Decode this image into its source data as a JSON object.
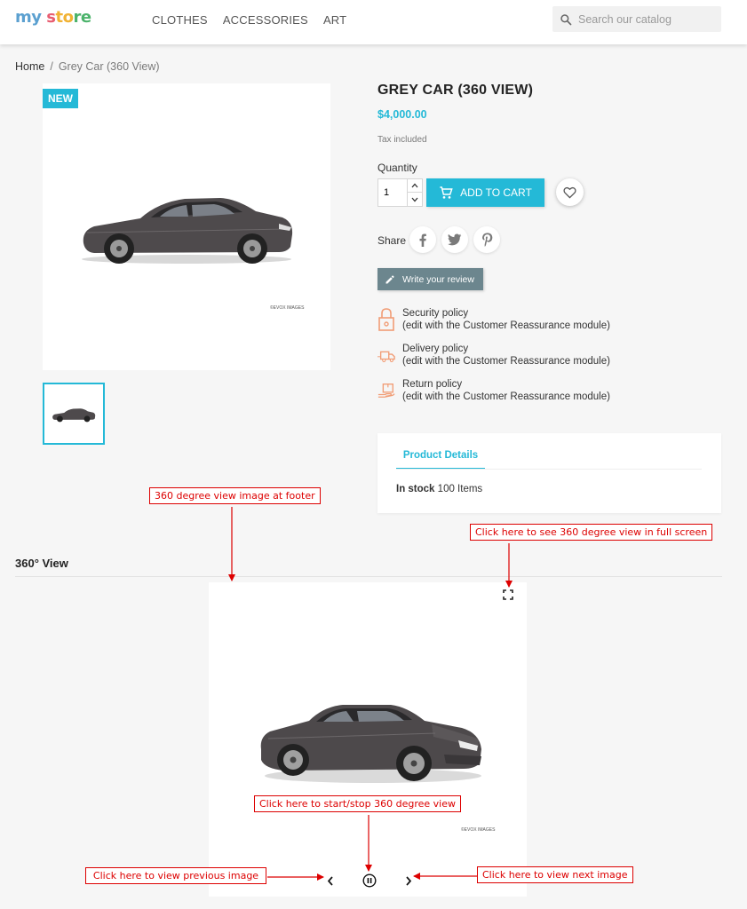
{
  "header": {
    "logo": {
      "my": "my",
      "s": "s",
      "to": "to",
      "re": "re"
    },
    "nav": [
      "CLOTHES",
      "ACCESSORIES",
      "ART"
    ],
    "search_placeholder": "Search our catalog"
  },
  "breadcrumb": {
    "home": "Home",
    "separator": "/",
    "current": "Grey Car (360 View)"
  },
  "product": {
    "badge": "NEW",
    "title": "GREY CAR (360 VIEW)",
    "price": "$4,000.00",
    "tax_note": "Tax included",
    "quantity_label": "Quantity",
    "quantity_value": "1",
    "add_to_cart": "ADD TO CART",
    "share_label": "Share",
    "write_review": "Write your review",
    "watermark": "©EVOX IMAGES"
  },
  "reassurance": [
    {
      "title": "Security policy",
      "note": "(edit with the Customer Reassurance module)",
      "icon": "lock-icon"
    },
    {
      "title": "Delivery policy",
      "note": "(edit with the Customer Reassurance module)",
      "icon": "truck-icon"
    },
    {
      "title": "Return policy",
      "note": "(edit with the Customer Reassurance module)",
      "icon": "return-box-icon"
    }
  ],
  "details": {
    "tab": "Product Details",
    "stock_label": "In stock",
    "stock_value": "100 Items"
  },
  "viewer": {
    "section_title": "360° View"
  },
  "annotations": {
    "footer": "360 degree view image at footer",
    "fullscreen": "Click here to see 360 degree view in full screen",
    "startstop": "Click here to start/stop 360 degree view",
    "previous": "Click here to view previous image",
    "next": "Click here to view next image"
  },
  "colors": {
    "accent": "#24b9d7",
    "review_button": "#6c868e",
    "annotation": "#dd0000",
    "reassurance_icon": "#f19d76"
  }
}
